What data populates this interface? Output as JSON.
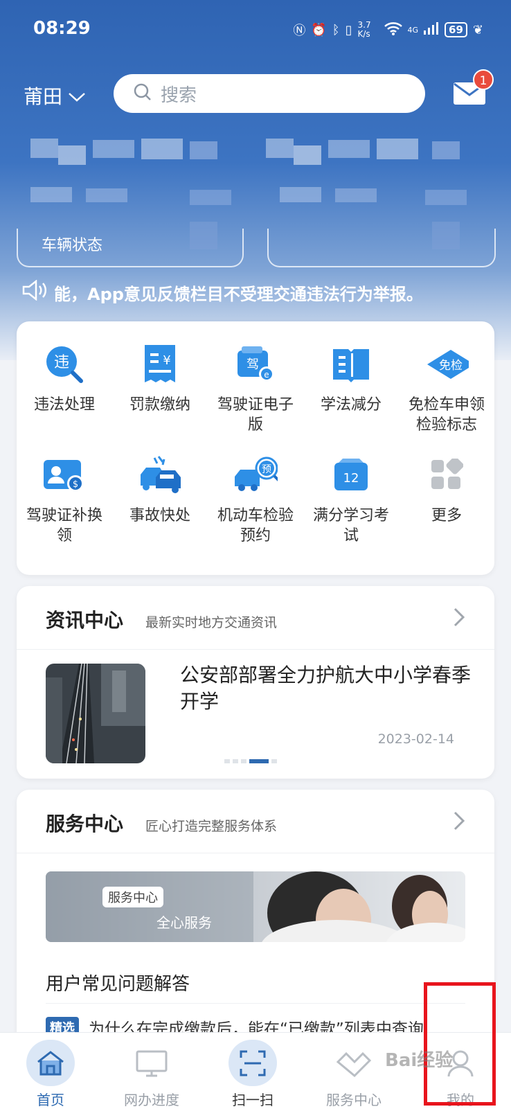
{
  "status_bar": {
    "time": "08:29",
    "net_speed": "3.7 K/s",
    "signal": "4G",
    "battery": "69"
  },
  "header": {
    "city": "莆田",
    "search_placeholder": "搜索",
    "mail_badge": "1"
  },
  "vehicle_card": {
    "label": "车辆状态"
  },
  "notice": {
    "text": "能，App意见反馈栏目不受理交通违法行为举报。"
  },
  "services": [
    {
      "label": "违法处理",
      "icon": "violation-search-icon"
    },
    {
      "label": "罚款缴纳",
      "icon": "fine-receipt-icon"
    },
    {
      "label": "驾驶证电子版",
      "icon": "e-license-icon"
    },
    {
      "label": "学法减分",
      "icon": "book-icon"
    },
    {
      "label": "免检车申领检验标志",
      "icon": "exempt-tag-icon",
      "tag": "免检"
    },
    {
      "label": "驾驶证补换领",
      "icon": "license-replace-icon"
    },
    {
      "label": "事故快处",
      "icon": "accident-icon"
    },
    {
      "label": "机动车检验预约",
      "icon": "inspection-booking-icon",
      "tag": "预"
    },
    {
      "label": "满分学习考试",
      "icon": "calendar-exam-icon",
      "tag": "12"
    },
    {
      "label": "更多",
      "icon": "more-grid-icon"
    }
  ],
  "news": {
    "title": "资讯中心",
    "subtitle": "最新实时地方交通资讯",
    "article_title": "公安部部署全力护航大中小学春季开学",
    "article_date": "2023-02-14",
    "carousel_index": 4,
    "carousel_count": 5
  },
  "service_center": {
    "title": "服务中心",
    "subtitle": "匠心打造完整服务体系",
    "banner_tag": "服务中心",
    "banner_text": "全心服务",
    "faq_heading": "用户常见问题解答",
    "faq_tag": "精选",
    "faq_question": "为什么在完成缴款后，能在“已缴款”列表中查询…"
  },
  "tabbar": [
    {
      "label": "首页",
      "active": true
    },
    {
      "label": "网办进度",
      "active": false
    },
    {
      "label": "扫一扫",
      "active": false
    },
    {
      "label": "服务中心",
      "active": false
    },
    {
      "label": "我的",
      "active": false
    }
  ],
  "watermark": "Bai经验",
  "colors": {
    "primary": "#2e6ab1",
    "hero_top": "#2f64b3",
    "badge": "#e94b3c",
    "highlight": "#e8141c"
  }
}
